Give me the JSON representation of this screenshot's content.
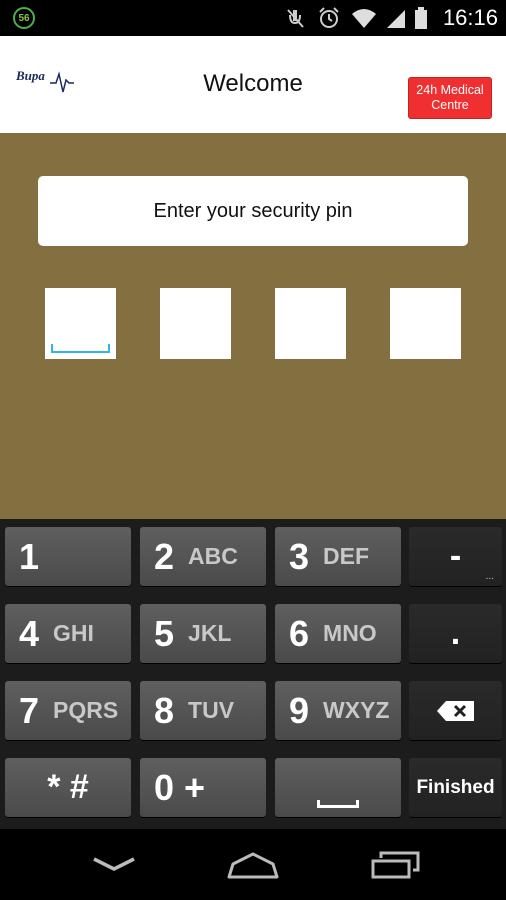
{
  "status_bar": {
    "notification_badge": "56",
    "time": "16:16",
    "icons": [
      "mute-icon",
      "alarm-icon",
      "wifi-icon",
      "signal-icon",
      "battery-icon"
    ]
  },
  "header": {
    "logo_text": "Bupa",
    "title": "Welcome",
    "medical_button_line1": "24h Medical",
    "medical_button_line2": "Centre"
  },
  "main": {
    "prompt": "Enter your security pin",
    "pin_length": 4
  },
  "keypad": {
    "keys": [
      {
        "num": "1",
        "letters": ""
      },
      {
        "num": "2",
        "letters": "ABC"
      },
      {
        "num": "3",
        "letters": "DEF"
      },
      {
        "num": "4",
        "letters": "GHI"
      },
      {
        "num": "5",
        "letters": "JKL"
      },
      {
        "num": "6",
        "letters": "MNO"
      },
      {
        "num": "7",
        "letters": "PQRS"
      },
      {
        "num": "8",
        "letters": "TUV"
      },
      {
        "num": "9",
        "letters": "WXYZ"
      },
      {
        "num": "* #",
        "letters": ""
      },
      {
        "num": "0 +",
        "letters": ""
      }
    ],
    "minus_label": "-",
    "more_dots": "...",
    "period_label": ".",
    "finished_label": "Finished"
  },
  "colors": {
    "background": "#836f40",
    "accent": "#f03030",
    "cursor": "#33b5e5"
  }
}
